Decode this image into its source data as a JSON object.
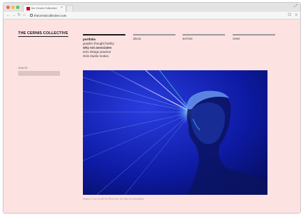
{
  "browser": {
    "tab_title": "the Cernis Collective",
    "tab_close": "×",
    "url": "thecerniscollective.com",
    "back_glyph": "←",
    "forward_glyph": "→",
    "reload_glyph": "↻",
    "home_glyph": "⌂",
    "resize_glyph": "⤢",
    "extension_glyph": "⭘",
    "menu_glyph": "≡",
    "traffic_lights": [
      "#ee6a5f",
      "#f5be4f",
      "#62c655"
    ]
  },
  "site": {
    "title": "THE CERNIS COLLECTIVE",
    "nav": [
      {
        "label": "portfolio",
        "active": true
      },
      {
        "label": "about",
        "active": false
      },
      {
        "label": "archive",
        "active": false
      },
      {
        "label": "news",
        "active": false
      }
    ],
    "submenu": {
      "current": "portfolio",
      "items": [
        "graphic thought facility",
        "why not associates",
        "intro design practice",
        "elvis studio motion"
      ],
      "bold_item": "why not associates"
    },
    "search_label": "search",
    "search_placeholder": "",
    "caption": "detail of 'Live for Art' by Elvin Lee, for why not associates"
  },
  "colors": {
    "page_bg": "#fde2e2",
    "hero_bg": "#0b1aa8",
    "accent": "#1a1a1a"
  },
  "icons": [
    "back-arrow-icon",
    "forward-arrow-icon",
    "reload-icon",
    "home-icon",
    "lock-icon",
    "extension-icon",
    "menu-icon",
    "resize-icon",
    "favicon-icon"
  ]
}
